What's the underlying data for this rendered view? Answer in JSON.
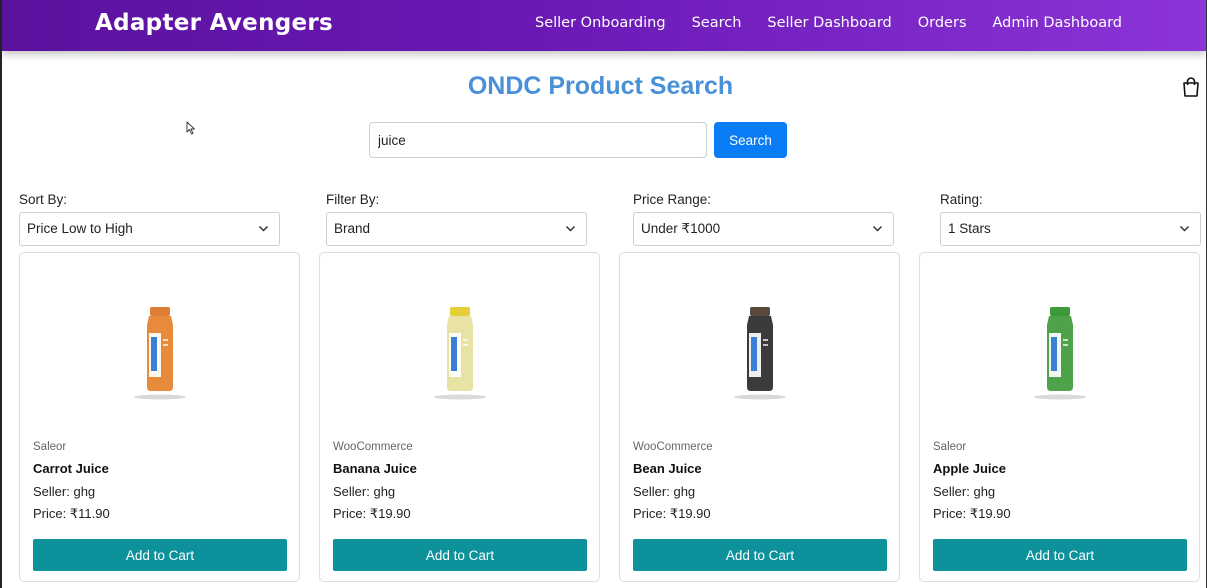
{
  "header": {
    "brand": "Adapter Avengers",
    "nav": [
      "Seller Onboarding",
      "Search",
      "Seller Dashboard",
      "Orders",
      "Admin Dashboard"
    ]
  },
  "page": {
    "title": "ONDC Product Search"
  },
  "search": {
    "value": "juice",
    "button_label": "Search"
  },
  "filters": [
    {
      "label": "Sort By:",
      "value": "Price Low to High"
    },
    {
      "label": "Filter By:",
      "value": "Brand"
    },
    {
      "label": "Price Range:",
      "value": "Under ₹1000"
    },
    {
      "label": "Rating:",
      "value": "1 Stars"
    }
  ],
  "products": [
    {
      "brand": "Saleor",
      "name": "Carrot Juice",
      "seller": "Seller: ghg",
      "price": "Price: ₹11.90",
      "color": "#e88a3c",
      "cap": "#e07d34"
    },
    {
      "brand": "WooCommerce",
      "name": "Banana Juice",
      "seller": "Seller: ghg",
      "price": "Price: ₹19.90",
      "color": "#e8e2a4",
      "cap": "#e4cf3a"
    },
    {
      "brand": "WooCommerce",
      "name": "Bean Juice",
      "seller": "Seller: ghg",
      "price": "Price: ₹19.90",
      "color": "#3b3b3d",
      "cap": "#5a4a3c"
    },
    {
      "brand": "Saleor",
      "name": "Apple Juice",
      "seller": "Seller: ghg",
      "price": "Price: ₹19.90",
      "color": "#4ea24a",
      "cap": "#3d9a3a"
    }
  ],
  "add_to_cart_label": "Add to Cart",
  "icons": {
    "cart": "shopping-bag-icon",
    "dropdown": "chevron-down-icon",
    "cursor": "mouse-pointer-icon"
  },
  "colors": {
    "nav_start": "#5b129e",
    "nav_end": "#8c34d8",
    "title": "#4a90d9",
    "search_button": "#0a7cf5",
    "add_button": "#0d929b"
  }
}
